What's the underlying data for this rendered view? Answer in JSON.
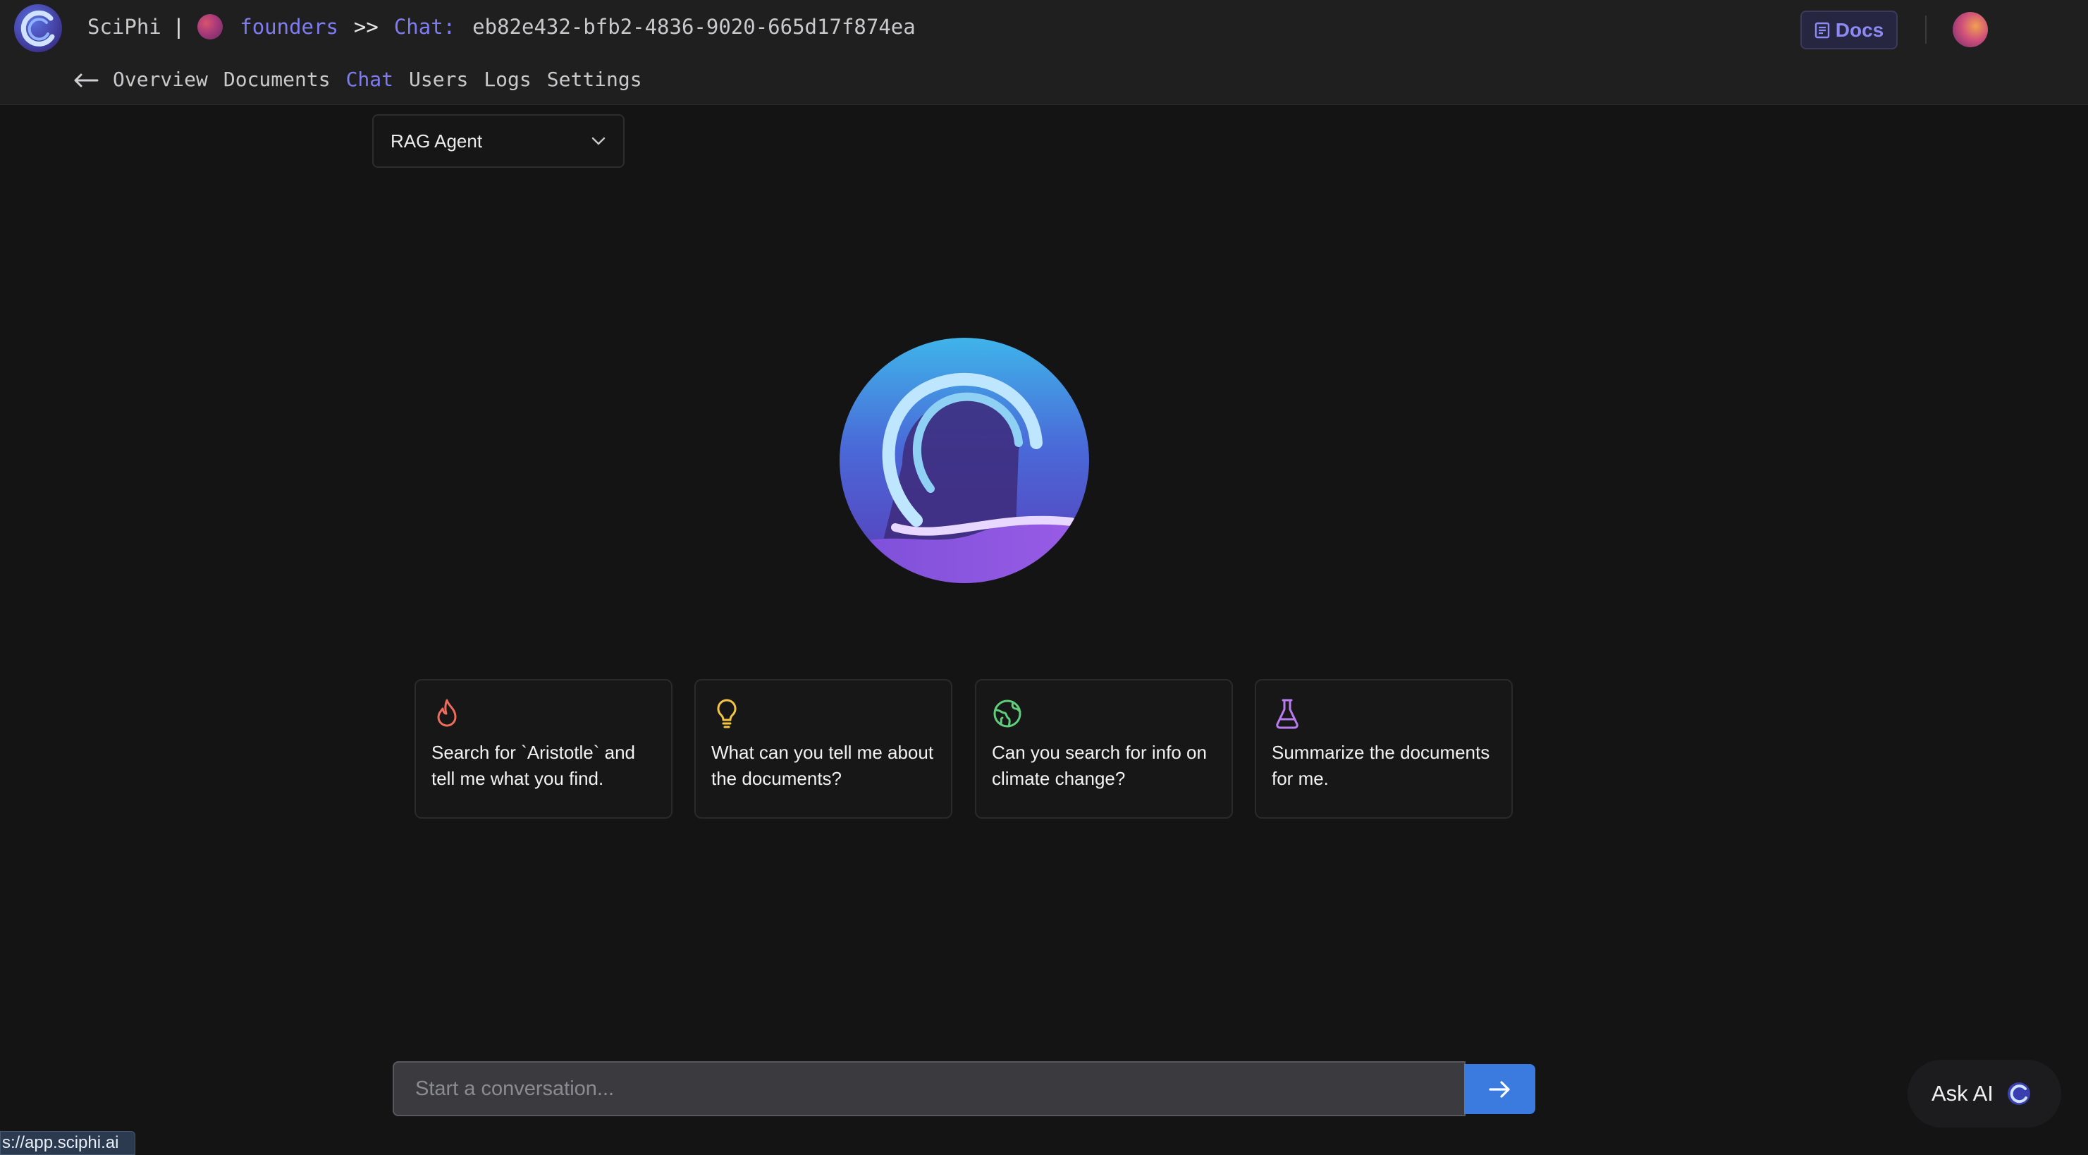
{
  "header": {
    "brand": "SciPhi",
    "pipe": "|",
    "project": "founders",
    "separator": ">>",
    "chat_label": "Chat:",
    "chat_id": "eb82e432-bfb2-4836-9020-665d17f874ea",
    "docs_label": "Docs",
    "icons": {
      "logo": "sciphi-logo-icon",
      "back": "arrow-left-icon",
      "docs": "document-icon"
    }
  },
  "nav": {
    "tabs": [
      {
        "label": "Overview",
        "active": false
      },
      {
        "label": "Documents",
        "active": false
      },
      {
        "label": "Chat",
        "active": true
      },
      {
        "label": "Users",
        "active": false
      },
      {
        "label": "Logs",
        "active": false
      },
      {
        "label": "Settings",
        "active": false
      }
    ]
  },
  "agent_select": {
    "value": "RAG Agent",
    "icon": "chevron-down-icon"
  },
  "suggestions": [
    {
      "icon": "flame-icon",
      "color": "#ef6b5b",
      "text": "Search for `Aristotle` and tell me what you find."
    },
    {
      "icon": "lightbulb-icon",
      "color": "#f5c542",
      "text": "What can you tell me about the documents?"
    },
    {
      "icon": "globe-icon",
      "color": "#5fce7a",
      "text": "Can you search for info on climate change?"
    },
    {
      "icon": "flask-icon",
      "color": "#b97cf0",
      "text": "Summarize the documents for me."
    }
  ],
  "composer": {
    "placeholder": "Start a conversation...",
    "value": ""
  },
  "ask_ai": {
    "label": "Ask AI"
  },
  "status_bar": {
    "url": "s://app.sciphi.ai"
  },
  "colors": {
    "accent": "#7f7cf0",
    "send_button": "#3b7be0",
    "background": "#141414"
  }
}
